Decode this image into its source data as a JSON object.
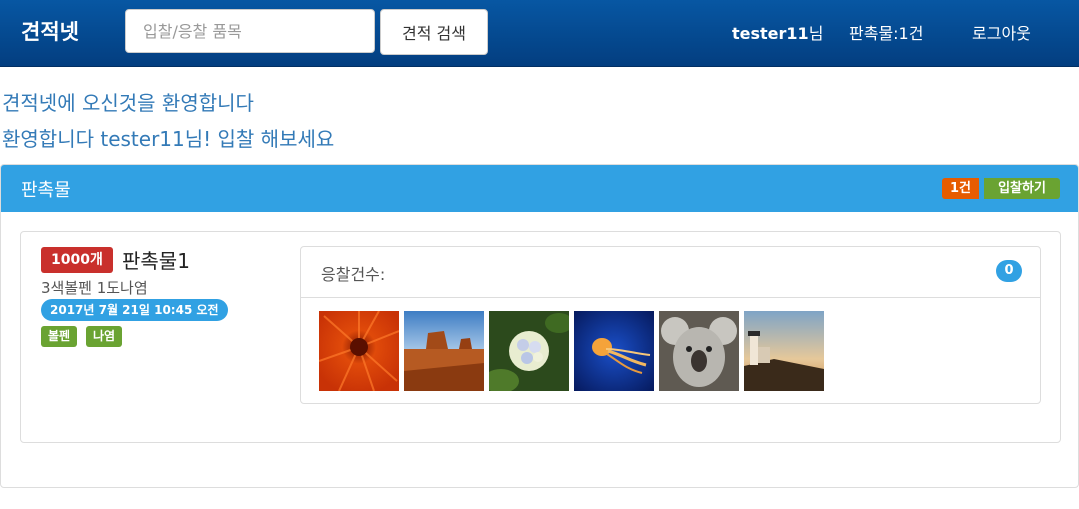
{
  "navbar": {
    "brand": "견적넷",
    "search_placeholder": "입찰/응찰 품목",
    "search_button": "견적 검색",
    "user_id": "tester11",
    "user_suffix": "님",
    "items_link": "판촉물:1건",
    "logout": "로그아웃"
  },
  "welcome": {
    "line1": "견적넷에 오신것을 환영합니다",
    "line2": "환영합니다 tester11님! 입찰 해보세요"
  },
  "panel": {
    "title": "판촉물",
    "count_badge": "1건",
    "bid_button": "입찰하기"
  },
  "item": {
    "quantity": "1000개",
    "name": "판촉물1",
    "description": "3색볼펜 1도나염",
    "date": "2017년 7월 21일 10:45 오전",
    "tags": [
      "볼펜",
      "나염"
    ]
  },
  "bids": {
    "label": "응찰건수:",
    "count": "0",
    "thumbnails": [
      {
        "icon": "chrysanthemum-photo"
      },
      {
        "icon": "desert-photo"
      },
      {
        "icon": "hydrangeas-photo"
      },
      {
        "icon": "jellyfish-photo"
      },
      {
        "icon": "koala-photo"
      },
      {
        "icon": "lighthouse-photo"
      }
    ]
  },
  "colors": {
    "navbar": "#0757a3",
    "panel_heading": "#31a1e3",
    "badge_orange": "#e65c00",
    "badge_green": "#6aa332",
    "badge_red": "#c9302c",
    "link_blue": "#337ab7"
  }
}
